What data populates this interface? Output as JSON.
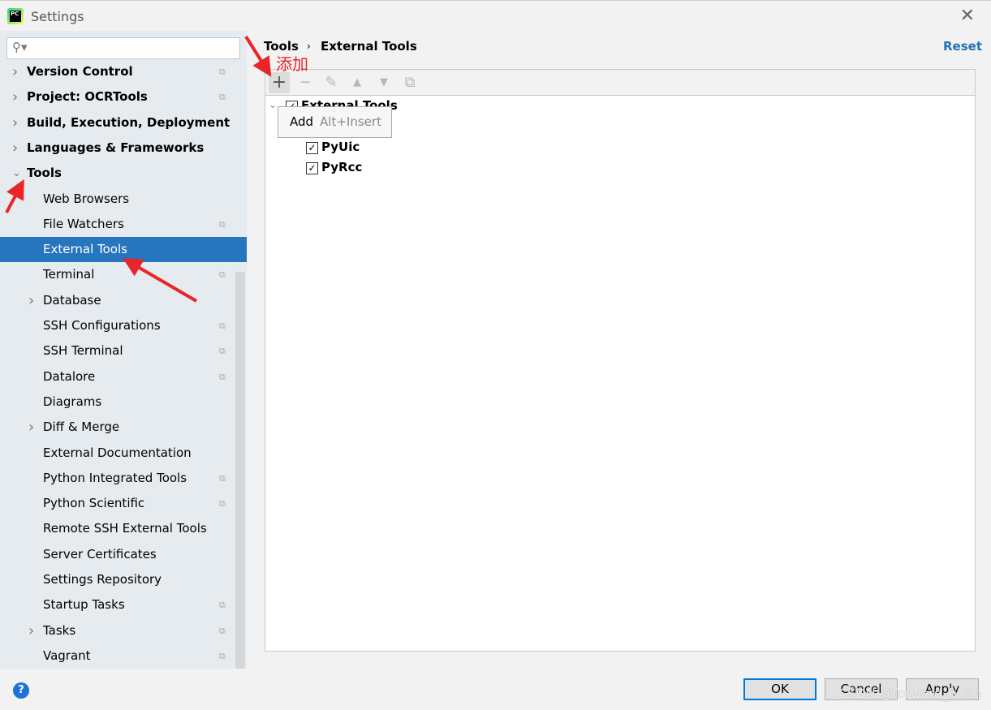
{
  "window": {
    "title": "Settings",
    "close_icon": "close-icon"
  },
  "search": {
    "placeholder": "",
    "icon": "search-icon"
  },
  "sidebar": {
    "items": [
      {
        "label": "Version Control",
        "bold": true,
        "expand": "collapsed",
        "copy": true
      },
      {
        "label": "Project: OCRTools",
        "bold": true,
        "expand": "collapsed",
        "copy": true
      },
      {
        "label": "Build, Execution, Deployment",
        "bold": true,
        "expand": "collapsed",
        "copy": false
      },
      {
        "label": "Languages & Frameworks",
        "bold": true,
        "expand": "collapsed",
        "copy": false
      },
      {
        "label": "Tools",
        "bold": true,
        "expand": "expanded",
        "copy": false
      },
      {
        "label": "Web Browsers",
        "copy": false
      },
      {
        "label": "File Watchers",
        "copy": true
      },
      {
        "label": "External Tools",
        "copy": false,
        "selected": true
      },
      {
        "label": "Terminal",
        "copy": true
      },
      {
        "label": "Database",
        "expand": "collapsed",
        "copy": false
      },
      {
        "label": "SSH Configurations",
        "copy": true
      },
      {
        "label": "SSH Terminal",
        "copy": true
      },
      {
        "label": "Datalore",
        "copy": true
      },
      {
        "label": "Diagrams",
        "copy": false
      },
      {
        "label": "Diff & Merge",
        "expand": "collapsed",
        "copy": false
      },
      {
        "label": "External Documentation",
        "copy": false
      },
      {
        "label": "Python Integrated Tools",
        "copy": true
      },
      {
        "label": "Python Scientific",
        "copy": true
      },
      {
        "label": "Remote SSH External Tools",
        "copy": false
      },
      {
        "label": "Server Certificates",
        "copy": false
      },
      {
        "label": "Settings Repository",
        "copy": false
      },
      {
        "label": "Startup Tasks",
        "copy": true
      },
      {
        "label": "Tasks",
        "expand": "collapsed",
        "copy": true
      },
      {
        "label": "Vagrant",
        "copy": true
      }
    ]
  },
  "breadcrumb": {
    "parent": "Tools",
    "separator": "›",
    "current": "External Tools"
  },
  "reset_label": "Reset",
  "toolbar": {
    "buttons": [
      "add-icon",
      "remove-icon",
      "edit-icon",
      "move-up-icon",
      "move-down-icon",
      "copy-icon"
    ]
  },
  "tree": {
    "group": "External Tools",
    "children": [
      "PyUic",
      "PyRcc"
    ]
  },
  "tooltip": {
    "label": "Add",
    "shortcut": "Alt+Insert"
  },
  "annotation": "添加",
  "buttons": {
    "ok": "OK",
    "cancel": "Cancel",
    "apply": "Apply"
  },
  "watermark": "CSDN @forward_huan",
  "colors": {
    "selection": "#2675bf",
    "annotation": "#e8262a",
    "link": "#2470b3"
  }
}
